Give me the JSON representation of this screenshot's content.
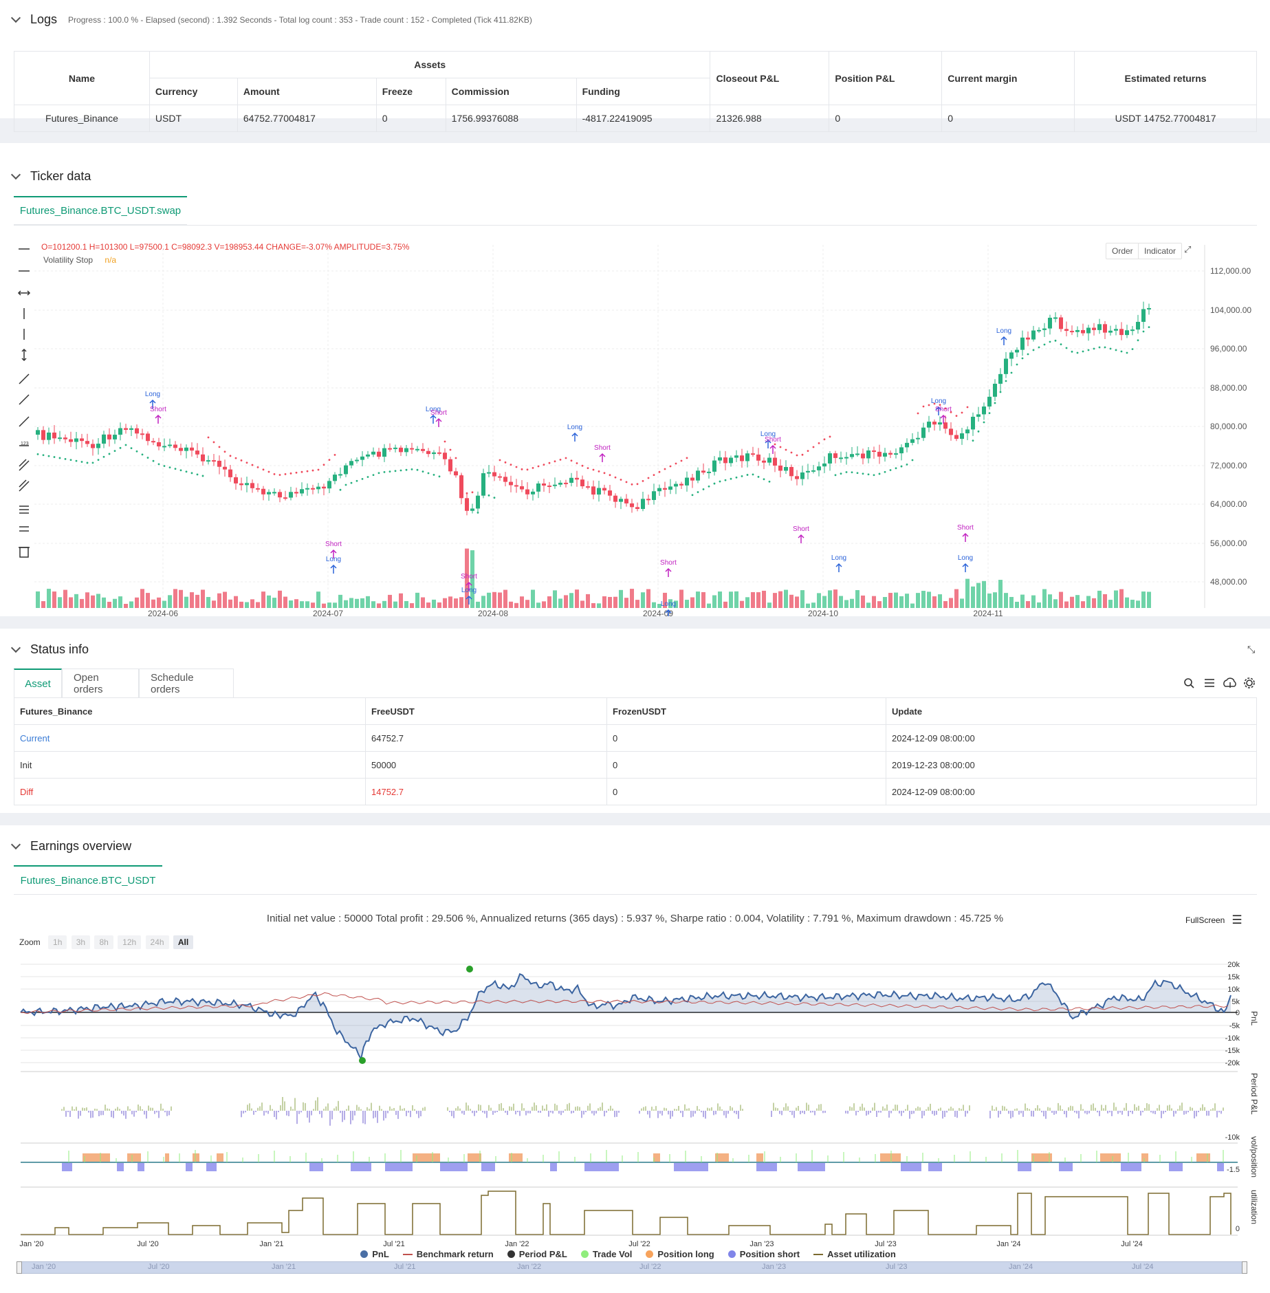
{
  "logs": {
    "title": "Logs",
    "summary": "Progress : 100.0 % - Elapsed (second) : 1.392  Seconds - Total log count : 353 - Trade count : 152 - Completed (Tick 411.82KB)",
    "table": {
      "headers": {
        "name": "Name",
        "assets": "Assets",
        "currency": "Currency",
        "amount": "Amount",
        "freeze": "Freeze",
        "commission": "Commission",
        "funding": "Funding",
        "closeout": "Closeout P&L",
        "position": "Position P&L",
        "margin": "Current margin",
        "est": "Estimated returns"
      },
      "row": {
        "name": "Futures_Binance",
        "currency": "USDT",
        "amount": "64752.77004817",
        "freeze": "0",
        "commission": "1756.99376088",
        "funding": "-4817.22419095",
        "closeout": "21326.988",
        "position": "0",
        "margin": "0",
        "est": "USDT 14752.77004817"
      }
    }
  },
  "ticker": {
    "title": "Ticker data",
    "tab": "Futures_Binance.BTC_USDT.swap",
    "ohlc": "O=101200.1 H=101300 L=97500.1 C=98092.3 V=198953.44 CHANGE=-3.07% AMPLITUDE=3.75%",
    "indicator_name": "Volatility Stop",
    "indicator_value": "n/a",
    "order_btn": "Order",
    "indicator_btn": "Indicator",
    "y_ticks": [
      "112,000.00",
      "104,000.00",
      "96,000.00",
      "88,000.00",
      "80,000.00",
      "72,000.00",
      "64,000.00",
      "56,000.00",
      "48,000.00"
    ],
    "x_ticks": [
      "2024-06",
      "2024-07",
      "2024-08",
      "2024-09",
      "2024-10",
      "2024-11"
    ],
    "trade_labels": [
      "Long",
      "Short",
      "1",
      "Long",
      "Short",
      "Long",
      "Short",
      "Long",
      "Short",
      "Long",
      "Short",
      "1",
      "Long",
      "Short",
      "Long",
      "Short",
      "Long",
      "Short",
      "Long",
      "Short",
      "Long",
      "1",
      "Long",
      "Short",
      "Long"
    ]
  },
  "status": {
    "title": "Status info",
    "tabs": [
      "Asset",
      "Open orders",
      "Schedule orders"
    ],
    "headers": [
      "Futures_Binance",
      "FreeUSDT",
      "FrozenUSDT",
      "Update"
    ],
    "rows": [
      {
        "label": "Current",
        "free": "64752.7",
        "frozen": "0",
        "update": "2024-12-09 08:00:00"
      },
      {
        "label": "Init",
        "free": "50000",
        "frozen": "0",
        "update": "2019-12-23 08:00:00"
      },
      {
        "label": "Diff",
        "free": "14752.7",
        "frozen": "0",
        "update": "2024-12-09 08:00:00"
      }
    ]
  },
  "earnings": {
    "title": "Earnings overview",
    "tab": "Futures_Binance.BTC_USDT",
    "summary": "Initial net value : 50000 Total profit : 29.506 %, Annualized returns (365 days) : 5.937 %, Sharpe ratio : 0.004, Volatility : 7.791 %, Maximum drawdown : 45.725 %",
    "fullscreen": "FullScreen",
    "zoom_label": "Zoom",
    "zoom_buttons": [
      "1h",
      "3h",
      "8h",
      "12h",
      "24h",
      "All"
    ],
    "pnl_ticks": [
      "20k",
      "15k",
      "10k",
      "5k",
      "0",
      "-5k",
      "-10k",
      "-15k",
      "-20k"
    ],
    "period_tick": "-10k",
    "pos_tick": "-1.5",
    "axis_titles": [
      "PnL",
      "Period P&L",
      "vol/position",
      "utilization"
    ],
    "x_ticks": [
      "Jan '20",
      "Jul '20",
      "Jan '21",
      "Jul '21",
      "Jan '22",
      "Jul '22",
      "Jan '23",
      "Jul '23",
      "Jan '24",
      "Jul '24"
    ],
    "legend": [
      {
        "name": "PnL",
        "color": "#4a6fa5",
        "kind": "dot"
      },
      {
        "name": "Benchmark return",
        "color": "#c0504d",
        "kind": "dash"
      },
      {
        "name": "Period P&L",
        "color": "#333333",
        "kind": "dot"
      },
      {
        "name": "Trade Vol",
        "color": "#90ed7d",
        "kind": "dot"
      },
      {
        "name": "Position long",
        "color": "#f7a35c",
        "kind": "dot"
      },
      {
        "name": "Position short",
        "color": "#8085e9",
        "kind": "dot"
      },
      {
        "name": "Asset utilization",
        "color": "#7b6a2e",
        "kind": "dash"
      }
    ]
  },
  "colors": {
    "up": "#26b07f",
    "down": "#ef4a5c",
    "accent": "#0e9a75",
    "link": "#3a7bd5"
  }
}
